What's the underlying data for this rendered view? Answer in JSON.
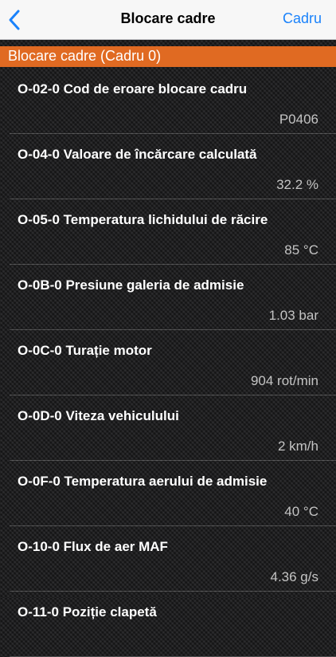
{
  "nav": {
    "title": "Blocare cadre",
    "action_label": "Cadru",
    "accent_color": "#1a82fb",
    "back_icon": "chevron-left-icon"
  },
  "section": {
    "title": "Blocare cadre (Cadru 0)",
    "color": "#e06a22"
  },
  "items": [
    {
      "label": "O-02-0 Cod de eroare blocare cadru",
      "value": "P0406"
    },
    {
      "label": "O-04-0 Valoare de încărcare calculată",
      "value": "32.2 %"
    },
    {
      "label": "O-05-0 Temperatura lichidului de răcire",
      "value": "85 °C"
    },
    {
      "label": "O-0B-0 Presiune galeria de admisie",
      "value": "1.03 bar"
    },
    {
      "label": "O-0C-0 Turație motor",
      "value": "904 rot/min"
    },
    {
      "label": "O-0D-0 Viteza vehiculului",
      "value": "2 km/h"
    },
    {
      "label": "O-0F-0 Temperatura aerului de admisie",
      "value": "40 °C"
    },
    {
      "label": "O-10-0 Flux de aer MAF",
      "value": "4.36 g/s"
    },
    {
      "label": "O-11-0 Poziție clapetă",
      "value": ""
    }
  ]
}
